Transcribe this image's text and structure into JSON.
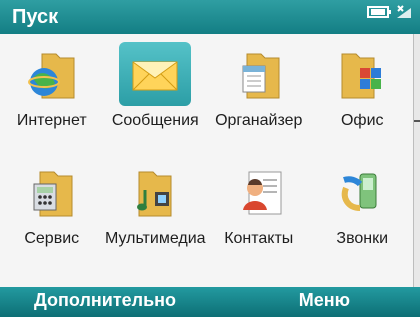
{
  "title": "Пуск",
  "status": {
    "battery_icon": "battery-icon",
    "signal_icon": "signal-icon"
  },
  "apps": [
    {
      "label": "Интернет",
      "icon": "internet-explorer-icon"
    },
    {
      "label": "Сообщения",
      "icon": "messages-envelope-icon",
      "selected": true
    },
    {
      "label": "Органайзер",
      "icon": "organizer-calendar-icon"
    },
    {
      "label": "Офис",
      "icon": "office-folder-icon"
    },
    {
      "label": "Сервис",
      "icon": "service-calculator-icon"
    },
    {
      "label": "Мультимедиа",
      "icon": "multimedia-folder-icon"
    },
    {
      "label": "Контакты",
      "icon": "contacts-card-icon"
    },
    {
      "label": "Звонки",
      "icon": "calls-phone-icon"
    }
  ],
  "softkeys": {
    "left": "Дополнительно",
    "right": "Меню"
  },
  "colors": {
    "accent": "#137e84",
    "selected": "#2c9ea6",
    "folder": "#e6b84b"
  }
}
